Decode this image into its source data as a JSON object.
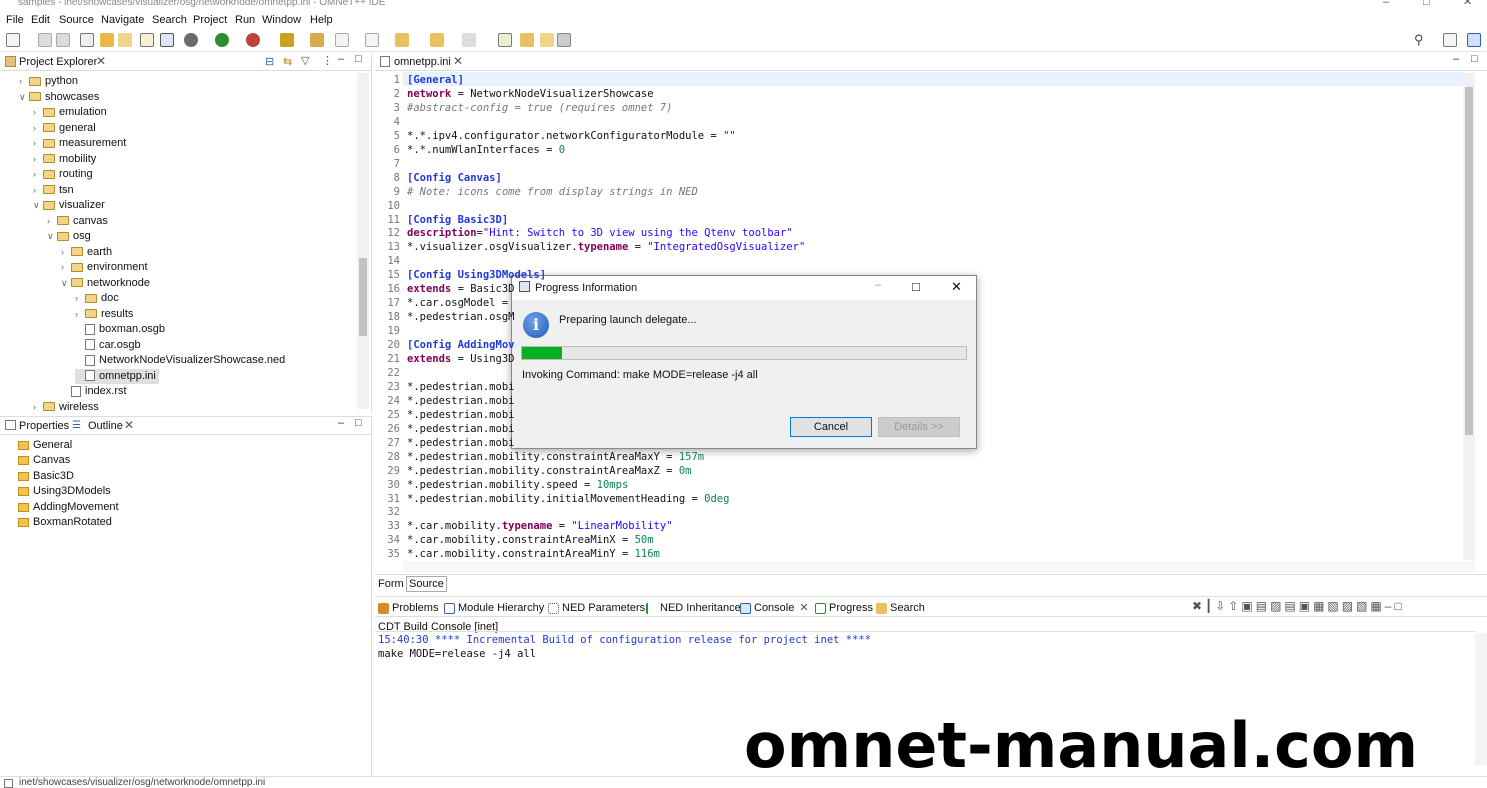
{
  "window": {
    "title": "samples - inet/showcases/visualizer/osg/networknode/omnetpp.ini - OMNeT++ IDE"
  },
  "menu": [
    "File",
    "Edit",
    "Source",
    "Navigate",
    "Search",
    "Project",
    "Run",
    "Window",
    "Help"
  ],
  "explorer": {
    "tab": "Project Explorer",
    "rows": [
      {
        "label": "python",
        "depth": 1,
        "kind": "folder",
        "arrow": ">"
      },
      {
        "label": "showcases",
        "depth": 1,
        "kind": "folder",
        "arrow": "v"
      },
      {
        "label": "emulation",
        "depth": 2,
        "kind": "folder",
        "arrow": ">"
      },
      {
        "label": "general",
        "depth": 2,
        "kind": "folder",
        "arrow": ">"
      },
      {
        "label": "measurement",
        "depth": 2,
        "kind": "folder",
        "arrow": ">"
      },
      {
        "label": "mobility",
        "depth": 2,
        "kind": "folder",
        "arrow": ">"
      },
      {
        "label": "routing",
        "depth": 2,
        "kind": "folder",
        "arrow": ">"
      },
      {
        "label": "tsn",
        "depth": 2,
        "kind": "folder",
        "arrow": ">"
      },
      {
        "label": "visualizer",
        "depth": 2,
        "kind": "folder",
        "arrow": "v"
      },
      {
        "label": "canvas",
        "depth": 3,
        "kind": "folder",
        "arrow": ">"
      },
      {
        "label": "osg",
        "depth": 3,
        "kind": "folder",
        "arrow": "v"
      },
      {
        "label": "earth",
        "depth": 4,
        "kind": "folder",
        "arrow": ">"
      },
      {
        "label": "environment",
        "depth": 4,
        "kind": "folder",
        "arrow": ">"
      },
      {
        "label": "networknode",
        "depth": 4,
        "kind": "folder",
        "arrow": "v"
      },
      {
        "label": "doc",
        "depth": 5,
        "kind": "folder",
        "arrow": ">"
      },
      {
        "label": "results",
        "depth": 5,
        "kind": "folder",
        "arrow": ">"
      },
      {
        "label": "boxman.osgb",
        "depth": 5,
        "kind": "file",
        "arrow": ""
      },
      {
        "label": "car.osgb",
        "depth": 5,
        "kind": "file",
        "arrow": ""
      },
      {
        "label": "NetworkNodeVisualizerShowcase.ned",
        "depth": 5,
        "kind": "file",
        "arrow": ""
      },
      {
        "label": "omnetpp.ini",
        "depth": 5,
        "kind": "file",
        "arrow": "",
        "selected": true
      },
      {
        "label": "index.rst",
        "depth": 4,
        "kind": "file",
        "arrow": ""
      },
      {
        "label": "wireless",
        "depth": 2,
        "kind": "folder",
        "arrow": ">"
      }
    ]
  },
  "outline": {
    "tab_properties": "Properties",
    "tab_outline": "Outline",
    "items": [
      "General",
      "Canvas",
      "Basic3D",
      "Using3DModels",
      "AddingMovement",
      "BoxmanRotated"
    ]
  },
  "editor": {
    "tab": "omnetpp.ini",
    "bottom_tabs": [
      "Form",
      "Source"
    ],
    "lines": [
      {
        "n": "1",
        "html": "<span class='sec'>[General]</span>"
      },
      {
        "n": "2",
        "html": "<span class='kw'>network</span> = NetworkNodeVisualizerShowcase"
      },
      {
        "n": "3",
        "html": "<span class='cm'>#abstract-config = true (requires omnet 7)</span>"
      },
      {
        "n": "4",
        "html": ""
      },
      {
        "n": "5",
        "html": "*.*.ipv4.configurator.networkConfiguratorModule = <span class='st'>\"\"</span>"
      },
      {
        "n": "6",
        "html": "*.*.numWlanInterfaces = <span class='num'>0</span>"
      },
      {
        "n": "7",
        "html": ""
      },
      {
        "n": "8",
        "html": "<span class='sec'>[Config Canvas]</span>"
      },
      {
        "n": "9",
        "html": "<span class='cm'># Note: icons come from display strings in NED</span>"
      },
      {
        "n": "10",
        "html": ""
      },
      {
        "n": "11",
        "html": "<span class='sec'>[Config Basic3D]</span>"
      },
      {
        "n": "12",
        "html": "<span class='kw'>description</span>=<span class='st'>\"Hint: Switch to 3D view using the Qtenv toolbar\"</span>"
      },
      {
        "n": "13",
        "html": "*.visualizer.osgVisualizer.<span class='kw'>typename</span> = <span class='st'>\"IntegratedOsgVisualizer\"</span>"
      },
      {
        "n": "14",
        "html": ""
      },
      {
        "n": "15",
        "html": "<span class='sec'>[Config Using3DModels]</span>"
      },
      {
        "n": "16",
        "html": "<span class='kw'>extends</span> = Basic3D"
      },
      {
        "n": "17",
        "html": "*.car.osgModel = "
      },
      {
        "n": "18",
        "html": "*.pedestrian.osgM"
      },
      {
        "n": "19",
        "html": ""
      },
      {
        "n": "20",
        "html": "<span class='sec'>[Config AddingMov</span>"
      },
      {
        "n": "21",
        "html": "<span class='kw'>extends</span> = Using3D"
      },
      {
        "n": "22",
        "html": ""
      },
      {
        "n": "23",
        "html": "*.pedestrian.mobi"
      },
      {
        "n": "24",
        "html": "*.pedestrian.mobi"
      },
      {
        "n": "25",
        "html": "*.pedestrian.mobi"
      },
      {
        "n": "26",
        "html": "*.pedestrian.mobi"
      },
      {
        "n": "27",
        "html": "*.pedestrian.mobi"
      },
      {
        "n": "28",
        "html": "*.pedestrian.mobility.constraintAreaMaxY = <span class='num'>157m</span>"
      },
      {
        "n": "29",
        "html": "*.pedestrian.mobility.constraintAreaMaxZ = <span class='num'>0m</span>"
      },
      {
        "n": "30",
        "html": "*.pedestrian.mobility.speed = <span class='num'>10mps</span>"
      },
      {
        "n": "31",
        "html": "*.pedestrian.mobility.initialMovementHeading = <span class='num'>0deg</span>"
      },
      {
        "n": "32",
        "html": ""
      },
      {
        "n": "33",
        "html": "*.car.mobility.<span class='kw'>typename</span> = <span class='st'>\"LinearMobility\"</span>"
      },
      {
        "n": "34",
        "html": "*.car.mobility.constraintAreaMinX = <span class='num'>50m</span>"
      },
      {
        "n": "35",
        "html": "*.car.mobility.constraintAreaMinY = <span class='num'>116m</span>"
      }
    ]
  },
  "bottom": {
    "tabs": [
      "Problems",
      "Module Hierarchy",
      "NED Parameters",
      "NED Inheritance",
      "Console",
      "Progress",
      "Search"
    ],
    "console_title": "CDT Build Console [inet]",
    "console_lines": [
      "15:40:30 **** Incremental Build of configuration release for project inet ****",
      "make MODE=release -j4 all"
    ]
  },
  "dialog": {
    "title": "Progress Information",
    "message": "Preparing launch delegate...",
    "progress": 0.09,
    "command": "Invoking Command: make MODE=release -j4 all",
    "cancel": "Cancel",
    "details": "Details >>"
  },
  "watermark": "omnet-manual.com",
  "status": {
    "path": "inet/showcases/visualizer/osg/networknode/omnetpp.ini"
  }
}
